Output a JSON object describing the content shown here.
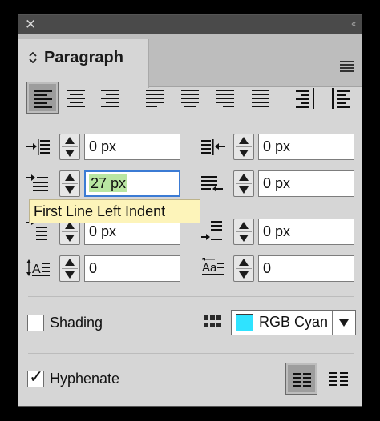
{
  "panel": {
    "close_glyph": "✕",
    "collapse_glyph": "‹‹",
    "tab": {
      "chevron": "◇",
      "label": "Paragraph"
    }
  },
  "alignment_buttons": [
    {
      "name": "align-left-icon",
      "selected": true
    },
    {
      "name": "align-center-icon",
      "selected": false
    },
    {
      "name": "align-right-icon",
      "selected": false
    },
    {
      "name": "justify-last-left-icon",
      "selected": false
    },
    {
      "name": "justify-last-center-icon",
      "selected": false
    },
    {
      "name": "justify-last-right-icon",
      "selected": false
    },
    {
      "name": "justify-all-icon",
      "selected": false
    },
    {
      "name": "align-towards-spine-icon",
      "selected": false
    },
    {
      "name": "align-away-from-spine-icon",
      "selected": false
    }
  ],
  "indents": {
    "left_indent": "0 px",
    "right_indent": "0 px",
    "first_line_left_indent": "27 px",
    "last_line_right_indent": "0 px",
    "space_before": "0 px",
    "space_after": "0 px",
    "drop_cap_lines": "0",
    "drop_cap_chars": "0"
  },
  "tooltip": {
    "text": "First Line Left Indent"
  },
  "shading": {
    "label": "Shading",
    "checked": false,
    "color_label": "RGB Cyan",
    "color_hex": "#2fe3ff"
  },
  "hyphenate": {
    "label": "Hyphenate",
    "checked": true,
    "check_glyph": "✓"
  }
}
